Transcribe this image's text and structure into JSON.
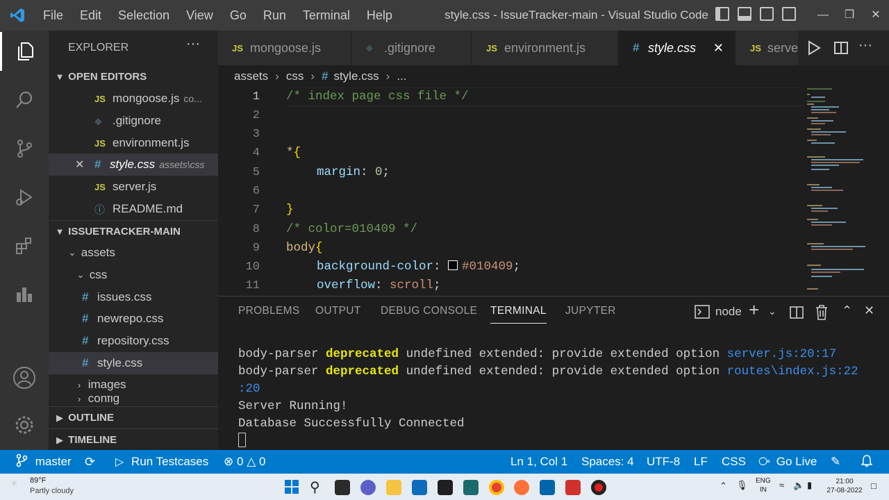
{
  "window": {
    "title": "style.css - IssueTracker-main - Visual Studio Code"
  },
  "menu": [
    "File",
    "Edit",
    "Selection",
    "View",
    "Go",
    "Run",
    "Terminal",
    "Help"
  ],
  "sidebar": {
    "header": "EXPLORER",
    "open_editors_label": "OPEN EDITORS",
    "open_editors": [
      {
        "icon": "JS",
        "name": "mongoose.js",
        "desc": "co..."
      },
      {
        "icon": "git",
        "name": ".gitignore",
        "desc": ""
      },
      {
        "icon": "JS",
        "name": "environment.js",
        "desc": ""
      },
      {
        "icon": "#",
        "name": "style.css",
        "desc": "assets\\css"
      },
      {
        "icon": "JS",
        "name": "server.js",
        "desc": ""
      },
      {
        "icon": "info",
        "name": "README.md",
        "desc": ""
      }
    ],
    "project_label": "ISSUETRACKER-MAIN",
    "tree": {
      "assets": "assets",
      "css": "css",
      "files": [
        "issues.css",
        "newrepo.css",
        "repository.css",
        "style.css"
      ],
      "images": "images",
      "config": "config"
    },
    "outline_label": "OUTLINE",
    "timeline_label": "TIMELINE"
  },
  "tabs": [
    "mongoose.js",
    ".gitignore",
    "environment.js",
    "style.css",
    "serve"
  ],
  "breadcrumb": [
    "assets",
    "css",
    "style.css",
    "..."
  ],
  "code": {
    "line_numbers": [
      "1",
      "2",
      "3",
      "4",
      "5",
      "6",
      "7",
      "8",
      "9",
      "10",
      "11"
    ],
    "l1": "/* index page css file */",
    "l4a": "*",
    "l4b": "{",
    "l5a": "margin",
    "l5b": ": ",
    "l5c": "0",
    "l5d": ";",
    "l7": "}",
    "l8": "/* color=010409 */",
    "l9a": "body",
    "l9b": "{",
    "l10a": "background-color",
    "l10b": ": ",
    "l10c": "#010409",
    "l10d": ";",
    "l11a": "overflow",
    "l11b": ": ",
    "l11c": "scroll",
    "l11d": ";",
    "swatch_color": "#010409"
  },
  "panel": {
    "tabs": [
      "PROBLEMS",
      "OUTPUT",
      "DEBUG CONSOLE",
      "TERMINAL",
      "JUPYTER"
    ],
    "shell": "node",
    "lines": {
      "a1": "body-parser ",
      "a2": "deprecated",
      "a3": " undefined extended: provide extended option ",
      "a4": "server.js:20:17",
      "b1": "body-parser ",
      "b2": "deprecated",
      "b3": " undefined extended: provide extended option ",
      "b4": "routes\\index.js:22",
      "c1": ":20",
      "d": "Server Running!",
      "e": "Database Successfully Connected"
    }
  },
  "status": {
    "branch": "master",
    "run": "Run Testcases",
    "errors": "0",
    "warnings": "0",
    "position": "Ln 1, Col 1",
    "spaces": "Spaces: 4",
    "encoding": "UTF-8",
    "eol": "LF",
    "lang": "CSS",
    "golive": "Go Live"
  },
  "taskbar": {
    "temp": "89°F",
    "weather": "Partly cloudy",
    "lang1": "ENG",
    "lang2": "IN",
    "time": "21:00",
    "date": "27-08-2022"
  },
  "colors": {
    "accent": "#007acc",
    "title": "#3c3c3c",
    "sidebar": "#252526",
    "editor": "#1e1e1e"
  }
}
